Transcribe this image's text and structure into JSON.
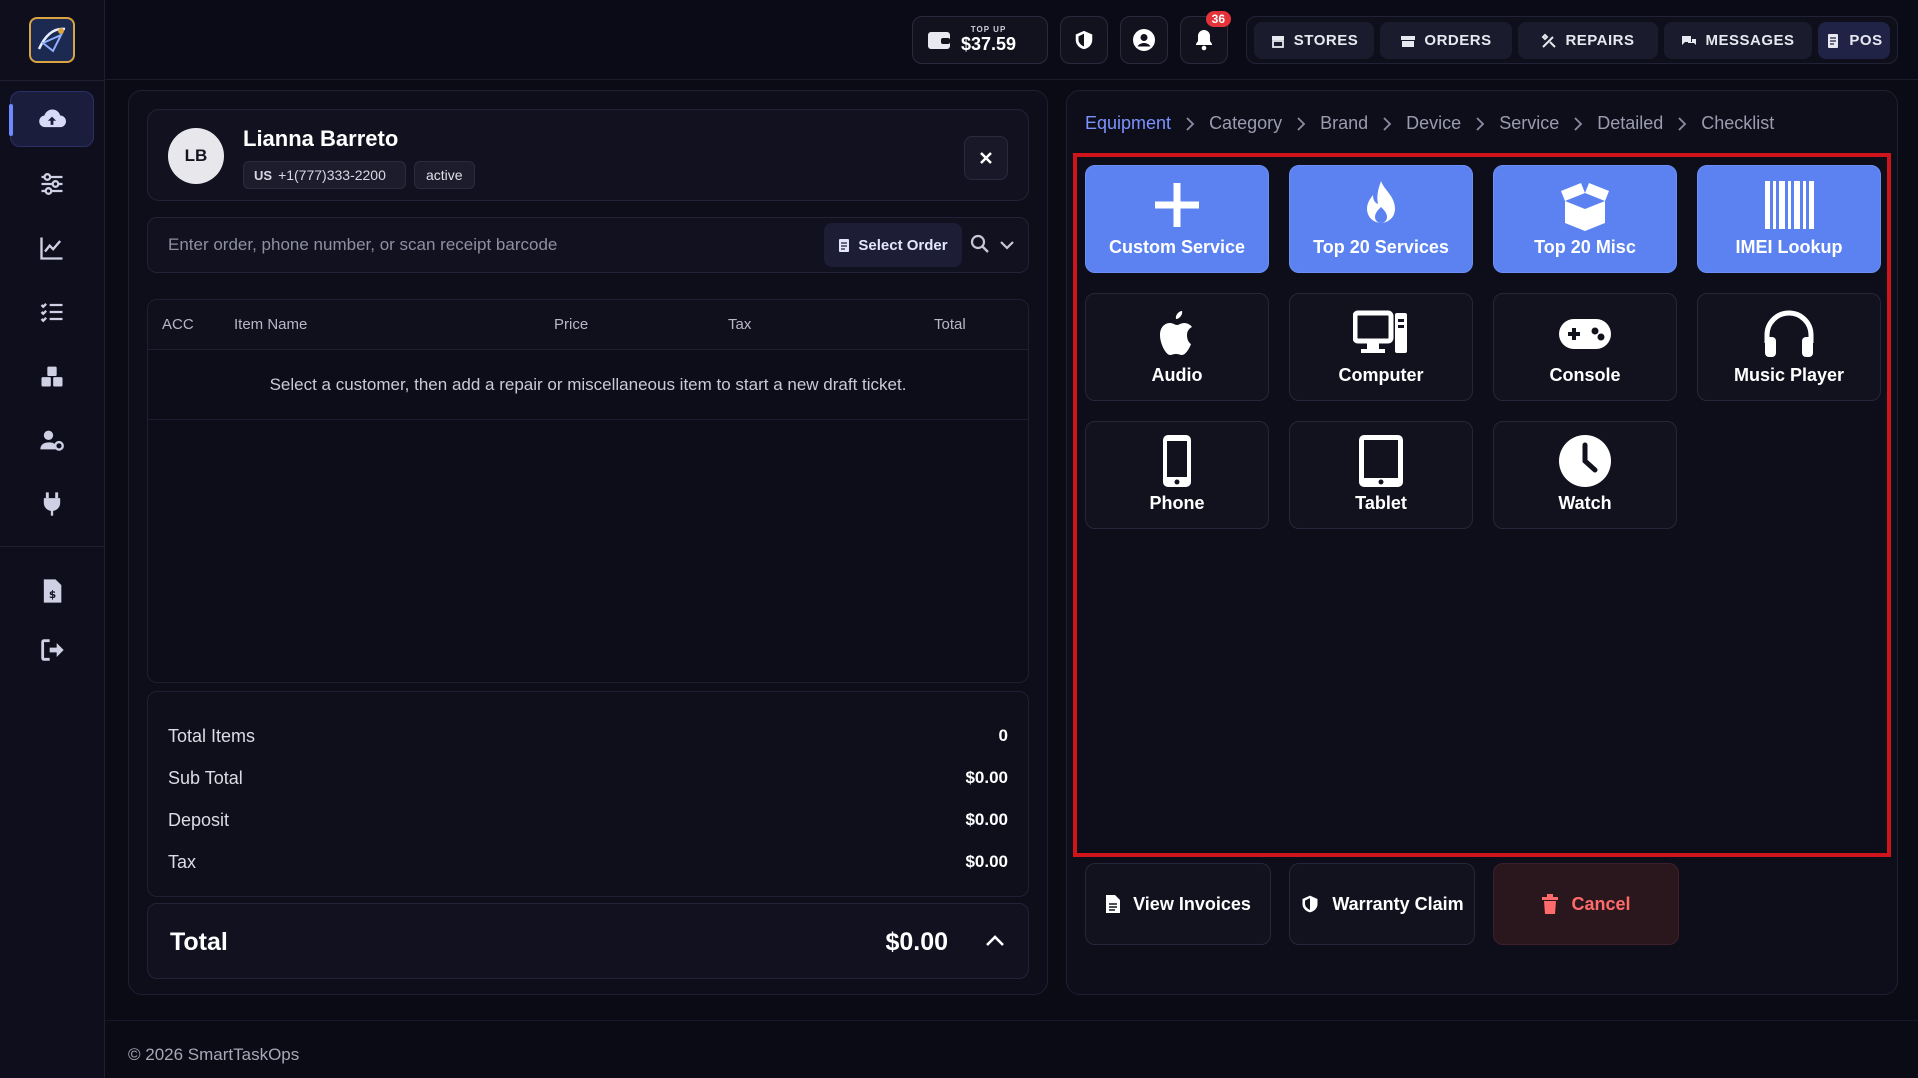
{
  "topbar": {
    "wallet": {
      "label": "TOP UP",
      "amount": "$37.59"
    },
    "notifications_count": "36",
    "nav": [
      {
        "label": "STORES",
        "icon": "store-icon"
      },
      {
        "label": "ORDERS",
        "icon": "box-icon"
      },
      {
        "label": "REPAIRS",
        "icon": "tools-icon"
      },
      {
        "label": "MESSAGES",
        "icon": "chat-icon"
      },
      {
        "label": "POS",
        "icon": "receipt-icon"
      }
    ]
  },
  "customer": {
    "initials": "LB",
    "name": "Lianna Barreto",
    "country_code": "US",
    "phone": "+1(777)333-2200",
    "status": "active"
  },
  "search": {
    "placeholder": "Enter order, phone number, or scan receipt barcode",
    "select_order_label": "Select Order"
  },
  "table": {
    "columns": [
      "ACC",
      "Item Name",
      "Price",
      "Tax",
      "Total"
    ],
    "empty_message": "Select a customer, then add a repair or miscellaneous item to start a new draft ticket."
  },
  "totals": {
    "rows": [
      {
        "label": "Total Items",
        "value": "0"
      },
      {
        "label": "Sub Total",
        "value": "$0.00"
      },
      {
        "label": "Deposit",
        "value": "$0.00"
      },
      {
        "label": "Tax",
        "value": "$0.00"
      }
    ],
    "grand_label": "Total",
    "grand_value": "$0.00"
  },
  "breadcrumb": [
    "Equipment",
    "Category",
    "Brand",
    "Device",
    "Service",
    "Detailed",
    "Checklist"
  ],
  "tiles": [
    {
      "label": "Custom Service",
      "icon": "plus-icon",
      "primary": true
    },
    {
      "label": "Top 20 Services",
      "icon": "fire-icon",
      "primary": true
    },
    {
      "label": "Top 20 Misc",
      "icon": "open-box-icon",
      "primary": true
    },
    {
      "label": "IMEI Lookup",
      "icon": "barcode-icon",
      "primary": true
    },
    {
      "label": "Audio",
      "icon": "apple-icon",
      "primary": false
    },
    {
      "label": "Computer",
      "icon": "desktop-icon",
      "primary": false
    },
    {
      "label": "Console",
      "icon": "gamepad-icon",
      "primary": false
    },
    {
      "label": "Music Player",
      "icon": "headphones-icon",
      "primary": false
    },
    {
      "label": "Phone",
      "icon": "phone-icon",
      "primary": false
    },
    {
      "label": "Tablet",
      "icon": "tablet-icon",
      "primary": false
    },
    {
      "label": "Watch",
      "icon": "clock-icon",
      "primary": false
    }
  ],
  "actions": {
    "view_invoices": "View Invoices",
    "warranty_claim": "Warranty Claim",
    "cancel": "Cancel"
  },
  "footer": {
    "text": "© 2026 SmartTaskOps"
  }
}
